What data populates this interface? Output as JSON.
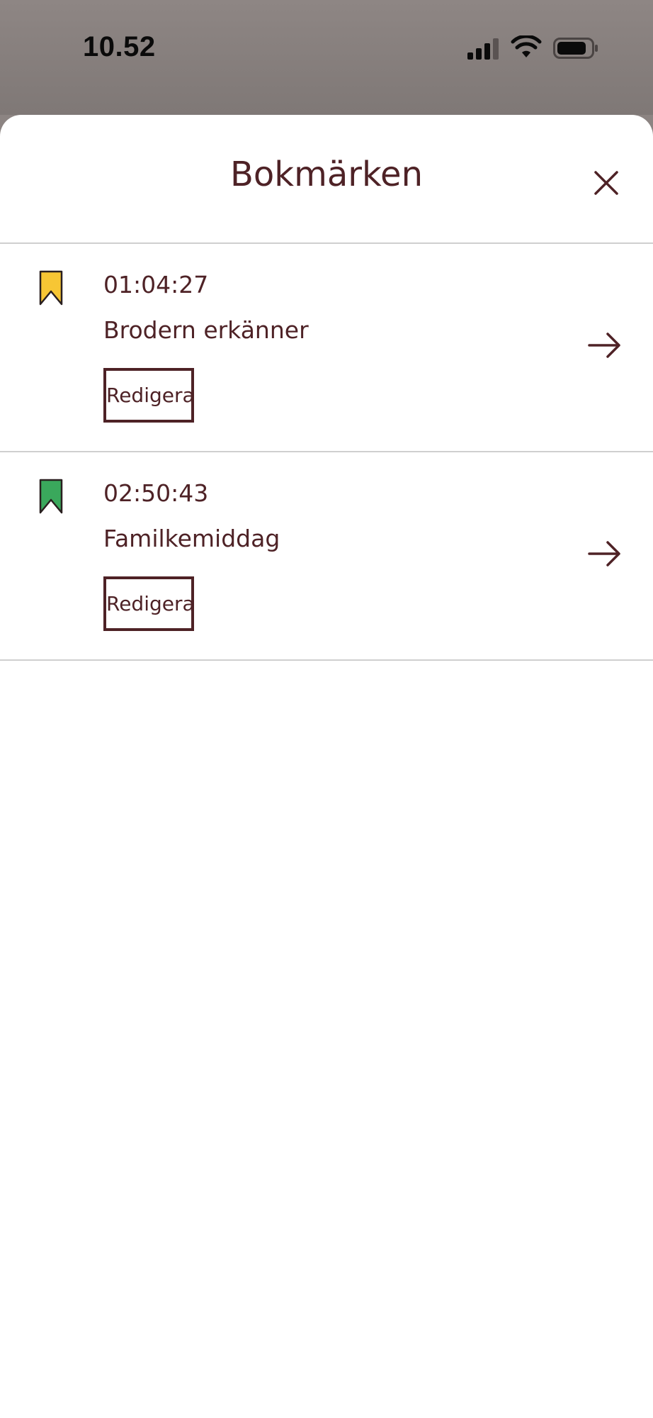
{
  "status_bar": {
    "time": "10.52",
    "icons": [
      "cellular-signal-icon",
      "wifi-icon",
      "battery-icon"
    ]
  },
  "sheet": {
    "title": "Bokmärken",
    "close_icon": "close-icon"
  },
  "bookmarks": [
    {
      "time": "01:04:27",
      "title": "Brodern erkänner",
      "edit_label": "Redigera",
      "color": "#f7c634",
      "icon": "bookmark-icon"
    },
    {
      "time": "02:50:43",
      "title": "Familkemiddag",
      "edit_label": "Redigera",
      "color": "#3aa85c",
      "icon": "bookmark-icon"
    }
  ],
  "colors": {
    "text": "#4e2226",
    "divider": "#cfcfcf",
    "backdrop": "#8c8482"
  }
}
